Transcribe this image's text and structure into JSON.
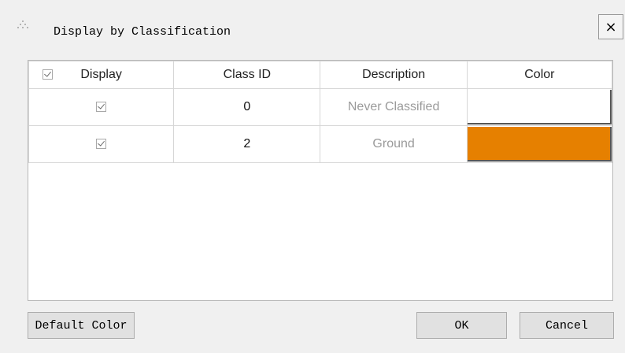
{
  "dialog": {
    "title": "Display by Classification",
    "close_symbol": "×",
    "icons": {
      "grip": "drag-grip-icon",
      "close": "close-icon",
      "checkbox": "checkbox-checked-icon"
    }
  },
  "table": {
    "columns": [
      "Display",
      "Class ID",
      "Description",
      "Color"
    ],
    "header_display_checked": true,
    "rows": [
      {
        "display": true,
        "class_id": "0",
        "description": "Never Classified",
        "color": "#ffffff"
      },
      {
        "display": true,
        "class_id": "2",
        "description": "Ground",
        "color": "#e68000"
      }
    ]
  },
  "buttons": {
    "default_color": "Default Color",
    "ok": "OK",
    "cancel": "Cancel"
  }
}
